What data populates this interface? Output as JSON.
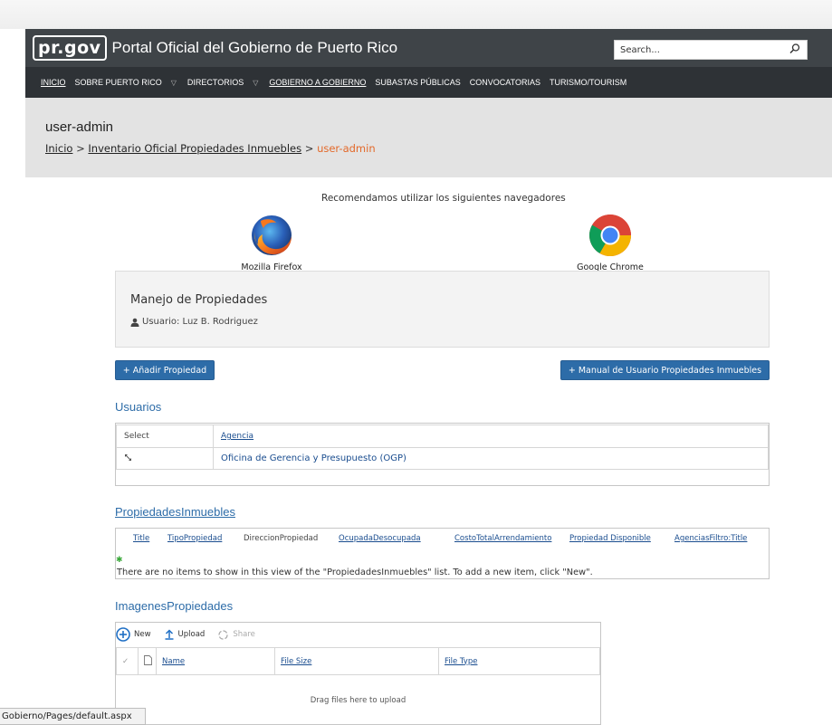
{
  "header": {
    "logo_text": "pr.gov",
    "site_title": "Portal Oficial del Gobierno de Puerto Rico",
    "search_placeholder": "Search..."
  },
  "nav": {
    "items": [
      {
        "label": "INICIO"
      },
      {
        "label": "SOBRE PUERTO RICO"
      },
      {
        "label": "DIRECTORIOS"
      },
      {
        "label": "GOBIERNO A GOBIERNO"
      },
      {
        "label": "SUBASTAS PÚBLICAS"
      },
      {
        "label": "CONVOCATORIAS"
      },
      {
        "label": "TURISMO/TOURISM"
      }
    ]
  },
  "title_area": {
    "page_title": "user-admin",
    "breadcrumb": [
      {
        "label": "Inicio"
      },
      {
        "label": "Inventario Oficial Propiedades Inmuebles"
      },
      {
        "label": "user-admin"
      }
    ],
    "separator": ">"
  },
  "browsers": {
    "recommend_text": "Recomendamos utilizar los siguientes navegadores",
    "firefox_label": "Mozilla Firefox",
    "chrome_label": "Google Chrome"
  },
  "panel": {
    "title": "Manejo de Propiedades",
    "user_text": "Usuario: Luz B. Rodriguez"
  },
  "buttons": {
    "add_property": "+ Añadir Propiedad",
    "manual": "+ Manual de Usuario Propiedades Inmuebles"
  },
  "users": {
    "title": "Usuarios",
    "columns": [
      "Select",
      "Agencia"
    ],
    "rows": [
      {
        "agencia": "Oficina de Gerencia y Presupuesto (OGP)"
      }
    ]
  },
  "properties": {
    "title": "PropiedadesInmuebles",
    "columns": [
      "Title",
      "TipoPropiedad",
      "DireccionPropiedad",
      "OcupadaDesocupada",
      "CostoTotalArrendamiento",
      "Propiedad Disponible",
      "AgenciasFiltro:Title"
    ],
    "empty_message": "There are no items to show in this view of the \"PropiedadesInmuebles\" list. To add a new item, click \"New\"."
  },
  "images": {
    "title": "ImagenesPropiedades",
    "toolbar": {
      "new": "New",
      "upload": "Upload",
      "share": "Share"
    },
    "columns": [
      "Name",
      "File Size",
      "File Type"
    ],
    "drop_text": "Drag files here to upload"
  },
  "status_bar": {
    "url": "Gobierno/Pages/default.aspx"
  },
  "colors": {
    "header_bg": "#3f4448",
    "nav_bg": "#2e3236",
    "accent_blue": "#2d6ca8",
    "breadcrumb_current": "#e3692a"
  }
}
